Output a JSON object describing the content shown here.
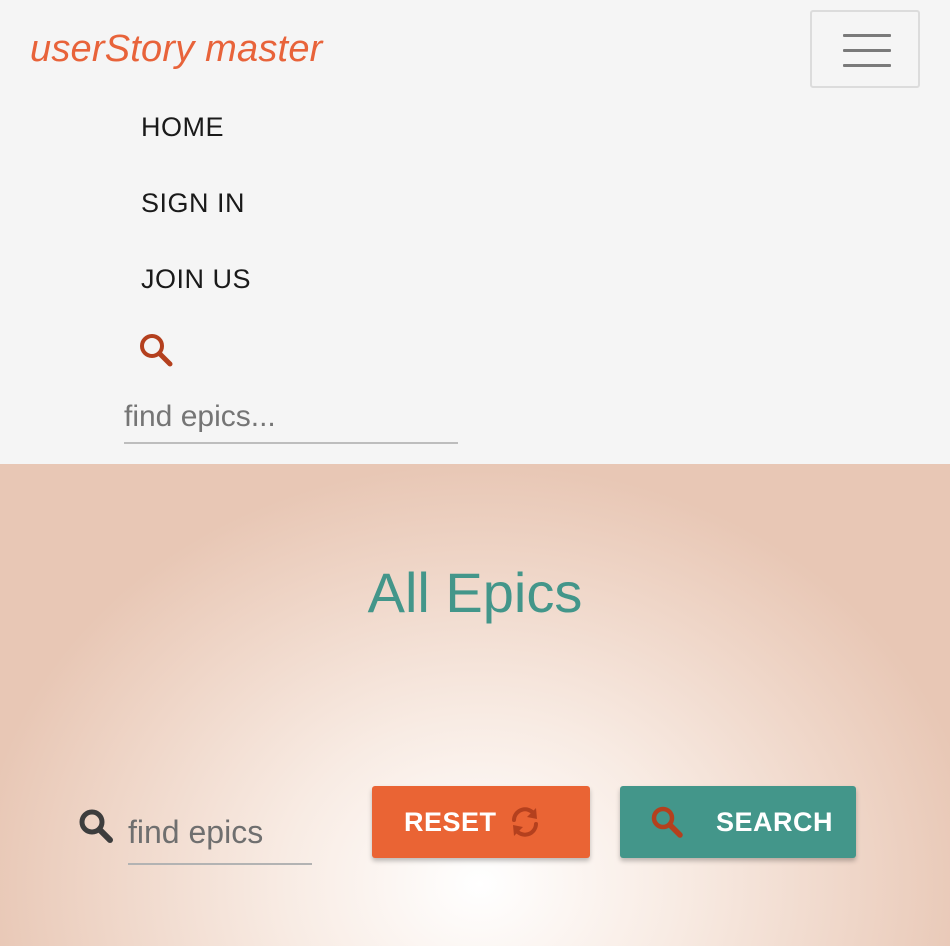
{
  "brand": {
    "title": "userStory master",
    "color": "#e8633a"
  },
  "nav": {
    "toggle_icon": "hamburger-menu-icon",
    "links": [
      {
        "label": "HOME"
      },
      {
        "label": "SIGN IN"
      },
      {
        "label": "JOIN US"
      }
    ],
    "search": {
      "icon": "search-icon",
      "placeholder": "find epics..."
    }
  },
  "hero": {
    "title": "All Epics",
    "title_color": "#43968a",
    "search": {
      "icon": "search-icon",
      "placeholder": "find epics"
    },
    "reset_button": {
      "label": "RESET",
      "icon": "refresh-icon",
      "color": "#ea6434"
    },
    "search_button": {
      "label": "SEARCH",
      "icon": "search-icon",
      "color": "#43968a"
    }
  }
}
